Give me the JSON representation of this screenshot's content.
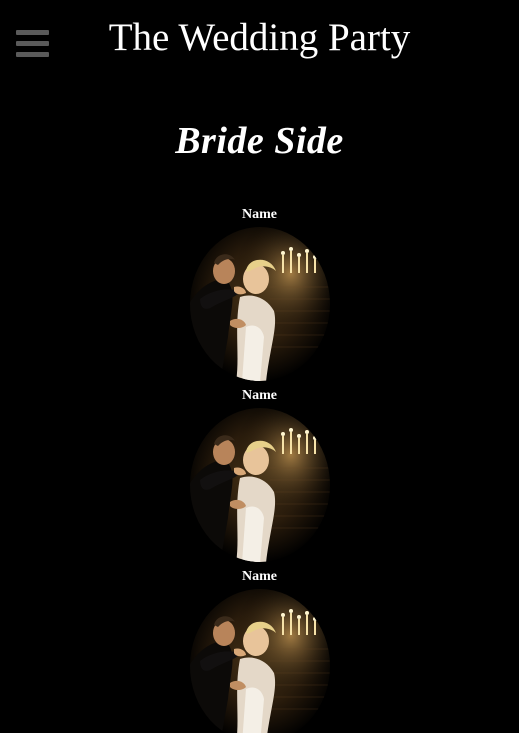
{
  "header": {
    "title": "The Wedding Party",
    "menu_icon": "hamburger-menu-icon"
  },
  "section": {
    "title": "Bride Side"
  },
  "members": [
    {
      "name": "Name",
      "photo": "couple-photo"
    },
    {
      "name": "Name",
      "photo": "couple-photo"
    },
    {
      "name": "Name",
      "photo": "couple-photo"
    }
  ],
  "colors": {
    "background": "#000000",
    "text": "#ffffff",
    "menu_icon": "#5a5a5a"
  }
}
